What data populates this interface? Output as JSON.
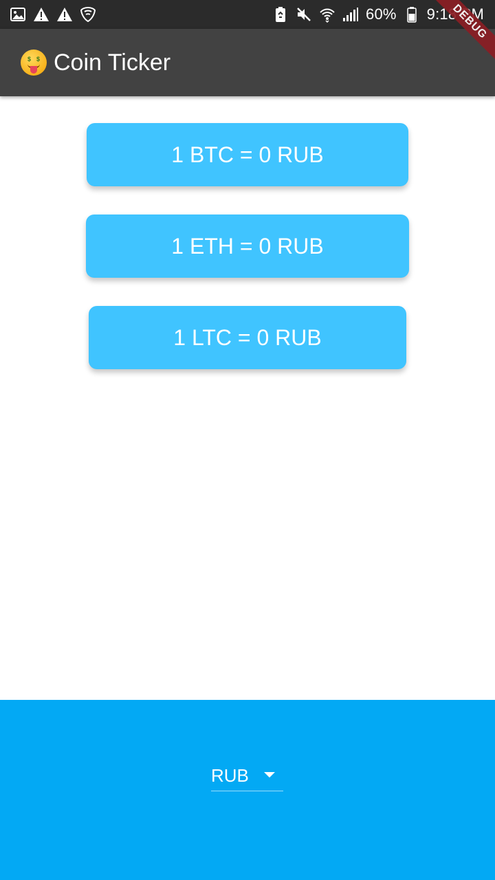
{
  "status_bar": {
    "left_icons": [
      "image-icon",
      "warning-icon",
      "warning-icon",
      "shield-icon"
    ],
    "right_icons": [
      "battery-saver-icon",
      "mute-icon",
      "wifi-icon",
      "signal-icon"
    ],
    "battery": "60%",
    "time": "9:18 PM"
  },
  "app_bar": {
    "emoji_icon": "money-mouth-face-icon",
    "title": "Coin Ticker"
  },
  "debug_banner": "DEBUG",
  "rates": [
    {
      "label": "1 BTC = 0 RUB"
    },
    {
      "label": "1 ETH = 0 RUB"
    },
    {
      "label": "1 LTC = 0 RUB"
    }
  ],
  "currency_picker": {
    "selected": "RUB",
    "arrow_icon": "dropdown-arrow-icon"
  },
  "colors": {
    "status_bar": "#2b2b2b",
    "app_bar": "#424242",
    "rate_card": "#40c4ff",
    "picker_area": "#03a9f4",
    "debug_ribbon": "#8b1e24"
  }
}
